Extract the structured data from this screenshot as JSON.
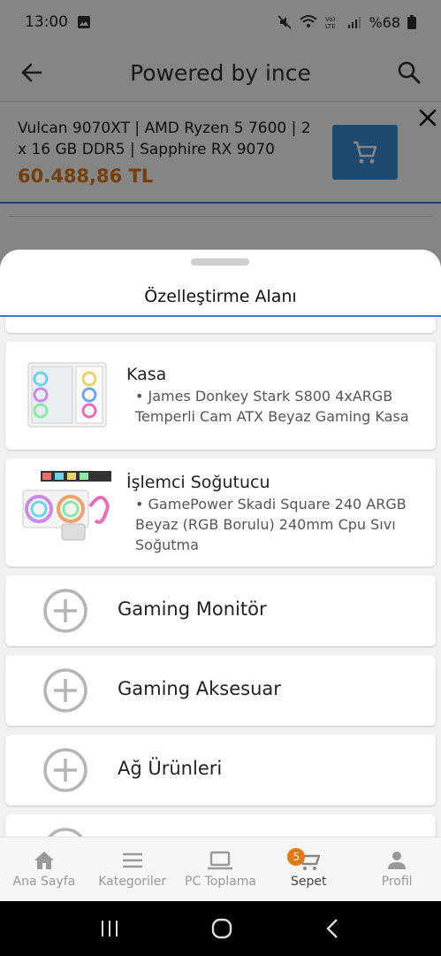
{
  "status_bar": {
    "time": "13:00",
    "battery": "%68"
  },
  "app_bar": {
    "title": "Powered by ince",
    "back_icon": "arrow-left-icon",
    "search_icon": "search-icon"
  },
  "cart_product": {
    "name": "Vulcan 9070XT | AMD Ryzen 5 7600 | 2 x 16 GB DDR5 | Sapphire RX 9070",
    "price": "60.488,86 TL",
    "add_to_cart_icon": "cart-icon",
    "close_icon": "close-icon"
  },
  "sheet": {
    "title": "Özelleştirme Alanı",
    "components": [
      {
        "category": "Kasa",
        "description": "• James Donkey Stark S800 4xARGB Temperli Cam ATX Beyaz Gaming Kasa"
      },
      {
        "category": "İşlemci Soğutucu",
        "description": "• GamePower Skadi Square 240 ARGB Beyaz (RGB Borulu) 240mm Cpu Sıvı Soğutma"
      }
    ],
    "add_options": [
      {
        "label": "Gaming Monitör"
      },
      {
        "label": "Gaming Aksesuar"
      },
      {
        "label": "Ağ Ürünleri"
      }
    ]
  },
  "bottom_nav": {
    "items": [
      {
        "label": "Ana Sayfa",
        "icon": "home-icon"
      },
      {
        "label": "Kategoriler",
        "icon": "menu-icon"
      },
      {
        "label": "PC Toplama",
        "icon": "laptop-icon"
      },
      {
        "label": "Sepet",
        "icon": "cart-icon",
        "badge": "5"
      },
      {
        "label": "Profil",
        "icon": "person-icon"
      }
    ],
    "active": "Sepet"
  },
  "colors": {
    "accent_blue": "#3a8fd6",
    "price_orange": "#e07a17"
  }
}
